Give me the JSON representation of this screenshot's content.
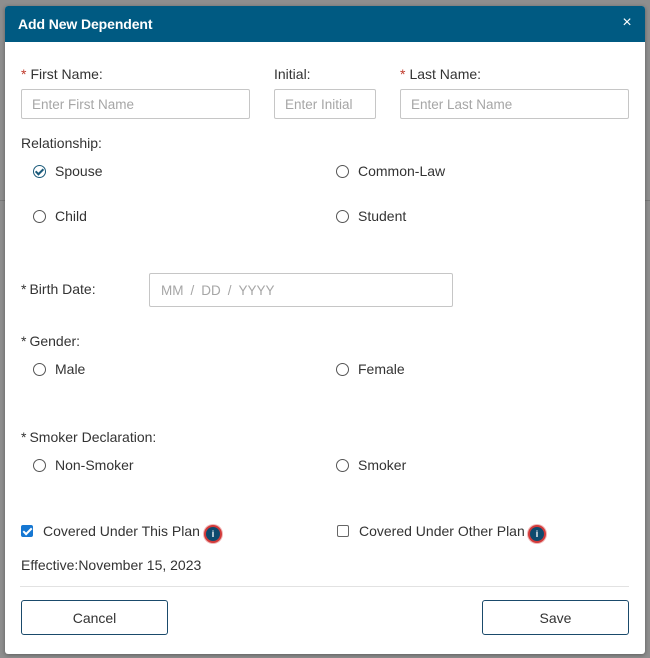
{
  "dialog": {
    "title": "Add New Dependent",
    "close_symbol": "×"
  },
  "name_fields": {
    "first_name": {
      "required_mark": "*",
      "label": "First Name:",
      "placeholder": "Enter First Name",
      "value": ""
    },
    "initial": {
      "label": "Initial:",
      "placeholder": "Enter Initial",
      "value": ""
    },
    "last_name": {
      "required_mark": "*",
      "label": "Last Name:",
      "placeholder": "Enter Last Name",
      "value": ""
    }
  },
  "relationship": {
    "label": "Relationship:",
    "options": [
      {
        "label": "Spouse",
        "selected": true
      },
      {
        "label": "Common-Law",
        "selected": false
      },
      {
        "label": "Child",
        "selected": false
      },
      {
        "label": "Student",
        "selected": false
      }
    ]
  },
  "birth_date": {
    "required_mark": "*",
    "label": "Birth Date:",
    "mm_placeholder": "MM",
    "dd_placeholder": "DD",
    "yyyy_placeholder": "YYYY",
    "separator": "/"
  },
  "gender": {
    "required_mark": "*",
    "label": "Gender:",
    "options": [
      {
        "label": "Male",
        "selected": false
      },
      {
        "label": "Female",
        "selected": false
      }
    ]
  },
  "smoker": {
    "required_mark": "*",
    "label": "Smoker Declaration:",
    "options": [
      {
        "label": "Non-Smoker",
        "selected": false
      },
      {
        "label": "Smoker",
        "selected": false
      }
    ]
  },
  "coverage": {
    "this_plan": {
      "label": "Covered Under This Plan",
      "checked": true,
      "info_icon": "info-icon"
    },
    "other_plan": {
      "label": "Covered Under Other Plan",
      "checked": false,
      "info_icon": "info-icon"
    }
  },
  "effective": {
    "text": "Effective:November 15, 2023"
  },
  "buttons": {
    "cancel": "Cancel",
    "save": "Save"
  },
  "colors": {
    "header_bg": "#005a82",
    "required_asterisk": "#c0392b",
    "checkbox_checked": "#1677d2",
    "info_ring": "#d23a3a",
    "button_border": "#1a4a6b"
  }
}
